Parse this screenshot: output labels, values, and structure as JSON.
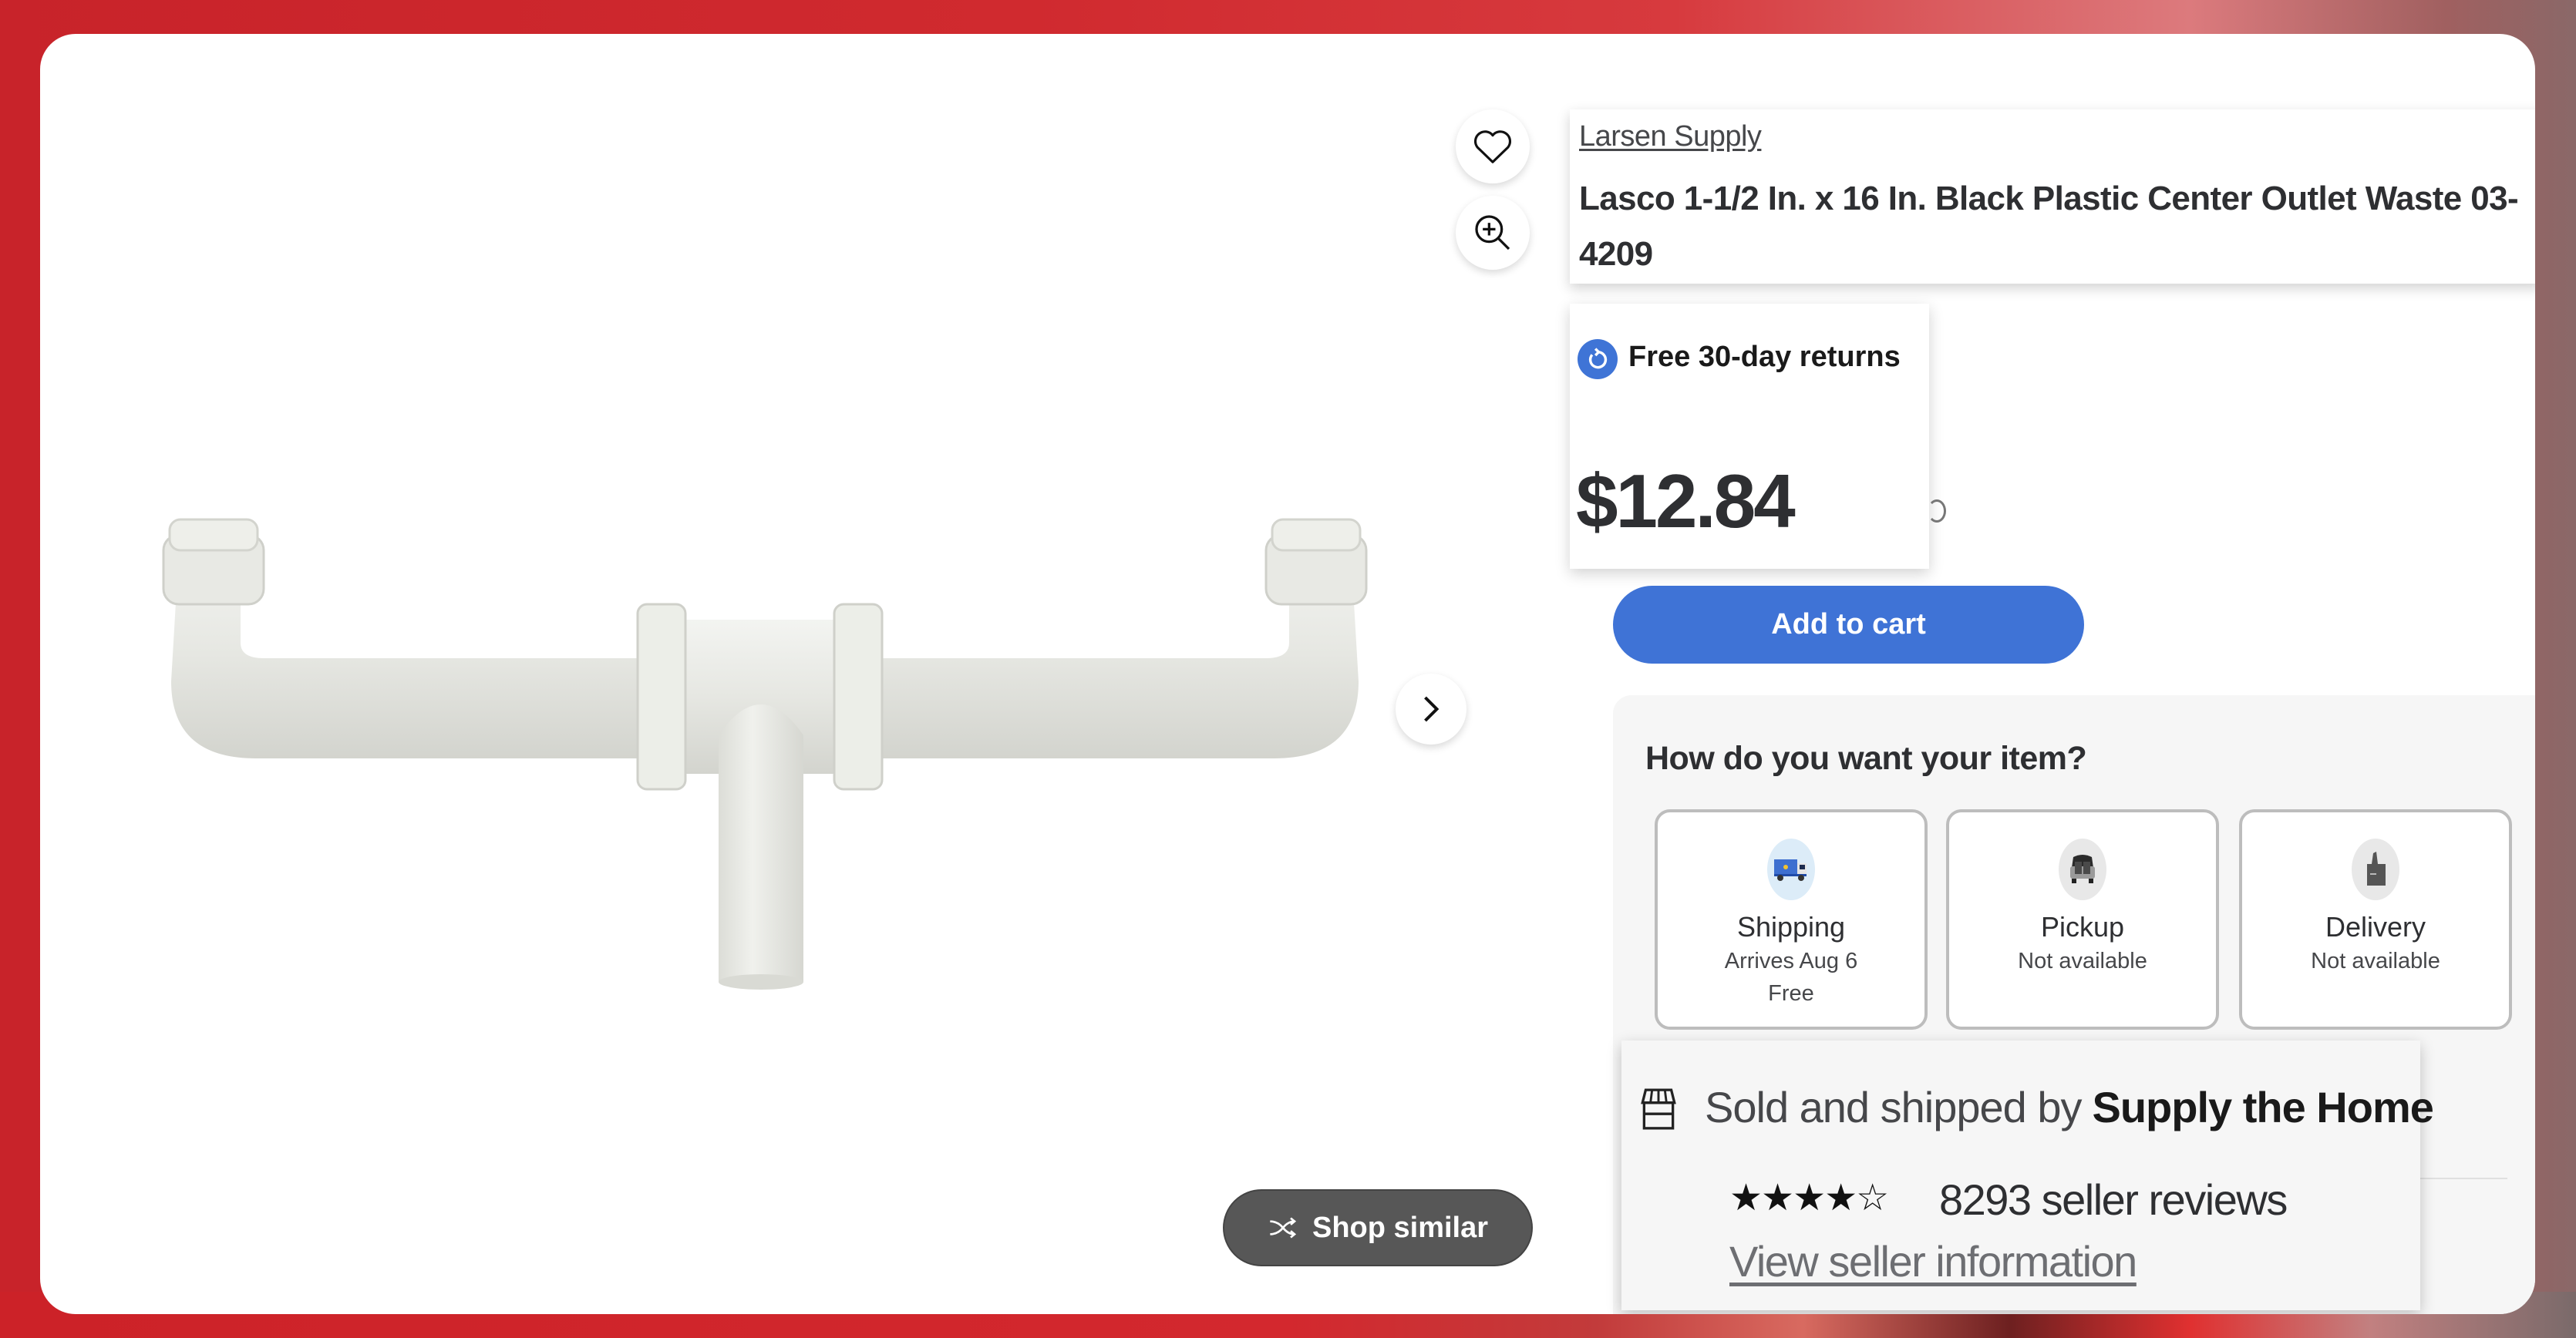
{
  "product": {
    "brand_link": "Larsen Supply",
    "title": "Lasco 1-1/2 In. x 16 In. Black Plastic Center Outlet Waste 03-1 4209",
    "title_line1": "Lasco 1-1/2 In. x 16 In. Black Plastic Center Outlet Waste 03-",
    "title_line2": "4209",
    "image_alt": "White plastic center outlet waste pipe assembly"
  },
  "gallery": {
    "favorite_icon": "heart-icon",
    "zoom_icon": "zoom-in-icon",
    "next_icon": "chevron-right-icon",
    "shop_similar_label": "Shop similar",
    "shop_similar_icon": "shuffle-icon"
  },
  "pricing": {
    "returns_label": "Free 30-day returns",
    "returns_icon": "return-arrow-icon",
    "price": "$12.84",
    "info_icon": "info-icon"
  },
  "actions": {
    "add_to_cart_label": "Add to cart",
    "accent_color": "#3f73d6"
  },
  "fulfillment": {
    "heading": "How do you want your item?",
    "options": [
      {
        "label": "Shipping",
        "sub1": "Arrives Aug 6",
        "sub2": "Free",
        "icon": "delivery-truck-icon"
      },
      {
        "label": "Pickup",
        "sub1": "Not available",
        "sub2": "",
        "icon": "car-pickup-icon"
      },
      {
        "label": "Delivery",
        "sub1": "Not available",
        "sub2": "",
        "icon": "shopping-bag-icon"
      }
    ],
    "hidden_link_text": "View seller information"
  },
  "seller": {
    "sold_by_prefix": "Sold and shipped by",
    "seller_name": "Supply the Home",
    "store_icon": "store-icon",
    "rating": 4,
    "rating_max": 5,
    "stars_text": "★★★★☆",
    "reviews_text": "8293 seller reviews",
    "view_info_link": "View seller information"
  }
}
